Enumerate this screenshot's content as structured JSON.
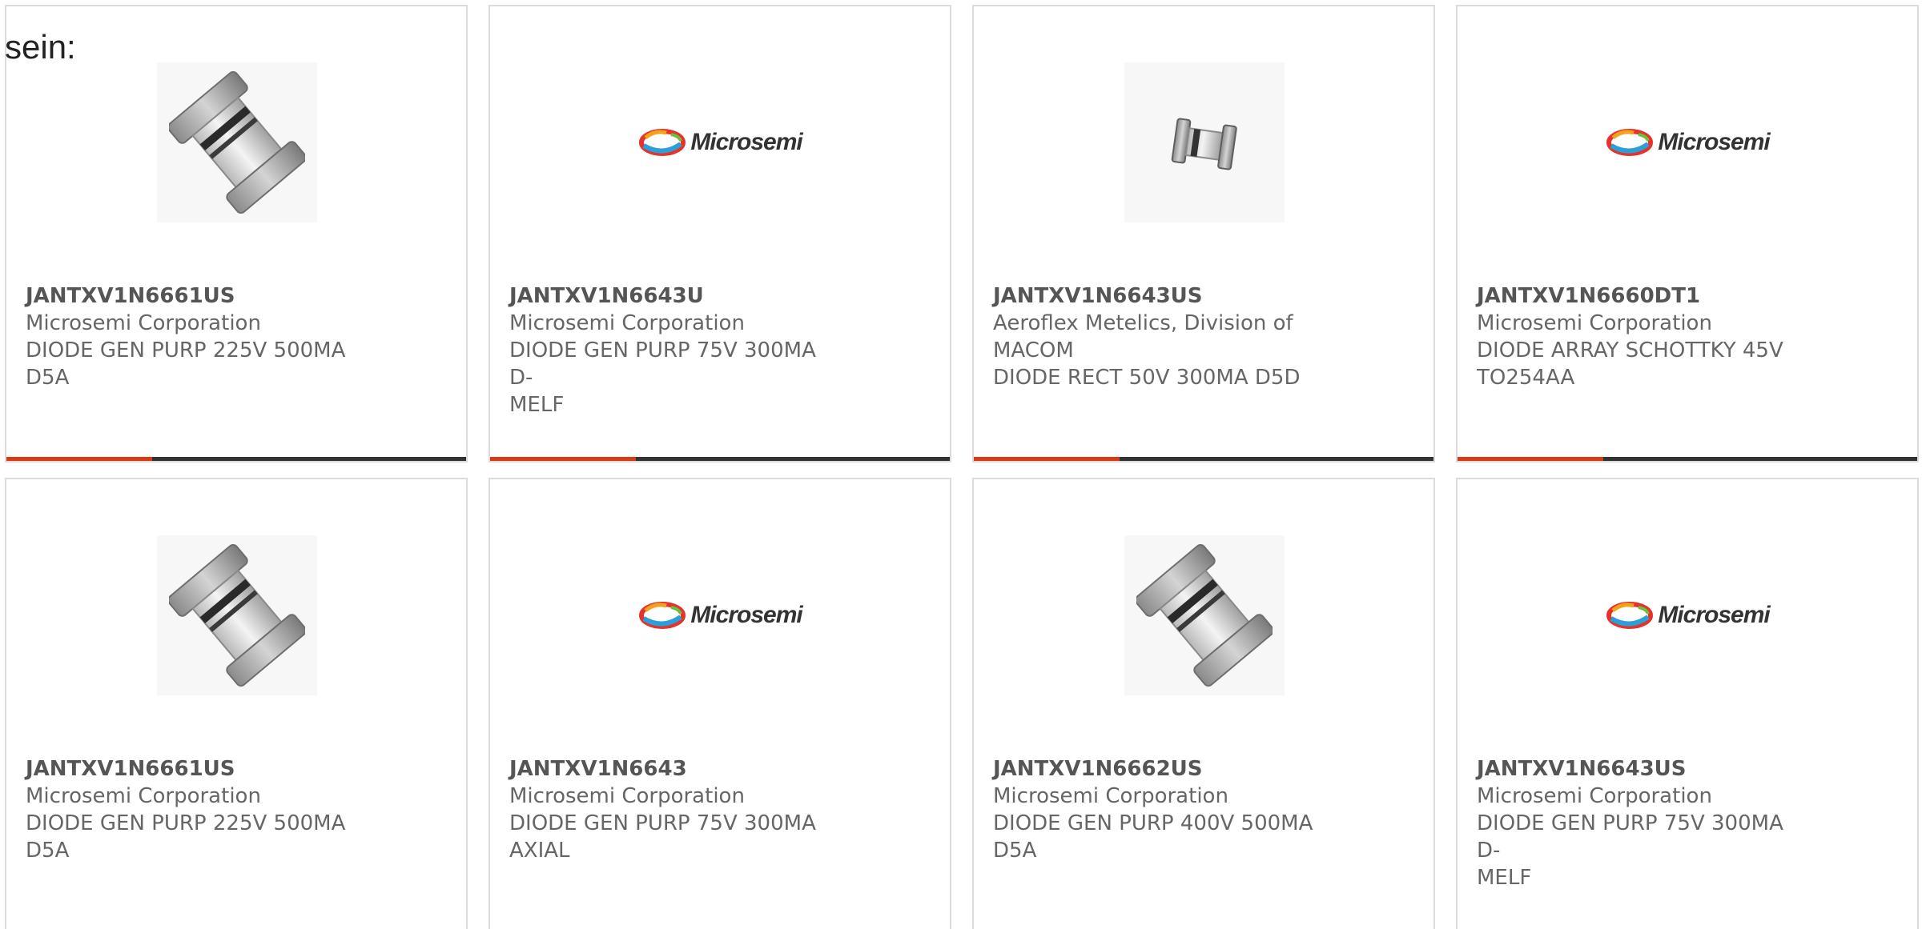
{
  "intro_text": "sein:",
  "colors": {
    "accent": "#d93a14",
    "bar": "#333333",
    "border": "#dcdcdc",
    "text": "#666666"
  },
  "cards": [
    {
      "part": "JANTXV1N6661US",
      "manufacturer": "Microsemi Corporation",
      "desc_line1": "DIODE GEN PURP 225V 500MA",
      "desc_line2": "D5A",
      "image": "diode-d5a-photo"
    },
    {
      "part": "JANTXV1N6643U",
      "manufacturer": "Microsemi Corporation",
      "desc_line1": "DIODE GEN PURP 75V 300MA D-",
      "desc_line2": "MELF",
      "image": "microsemi-logo",
      "logo_text": "Microsemi"
    },
    {
      "part": "JANTXV1N6643US",
      "manufacturer_line1": "Aeroflex Metelics, Division of",
      "manufacturer_line2": "MACOM",
      "desc_line1": "DIODE RECT 50V 300MA D5D",
      "image": "diode-small-photo"
    },
    {
      "part": "JANTXV1N6660DT1",
      "manufacturer": "Microsemi Corporation",
      "desc_line1": "DIODE ARRAY SCHOTTKY 45V",
      "desc_line2": "TO254AA",
      "image": "microsemi-logo",
      "logo_text": "Microsemi"
    },
    {
      "part": "JANTXV1N6661US",
      "manufacturer": "Microsemi Corporation",
      "desc_line1": "DIODE GEN PURP 225V 500MA",
      "desc_line2": "D5A",
      "image": "diode-d5a-photo"
    },
    {
      "part": "JANTXV1N6643",
      "manufacturer": "Microsemi Corporation",
      "desc_line1": "DIODE GEN PURP 75V 300MA",
      "desc_line2": "AXIAL",
      "image": "microsemi-logo",
      "logo_text": "Microsemi"
    },
    {
      "part": "JANTXV1N6662US",
      "manufacturer": "Microsemi Corporation",
      "desc_line1": "DIODE GEN PURP 400V 500MA",
      "desc_line2": "D5A",
      "image": "diode-d5a-photo"
    },
    {
      "part": "JANTXV1N6643US",
      "manufacturer": "Microsemi Corporation",
      "desc_line1": "DIODE GEN PURP 75V 300MA D-",
      "desc_line2": "MELF",
      "image": "microsemi-logo",
      "logo_text": "Microsemi"
    }
  ]
}
